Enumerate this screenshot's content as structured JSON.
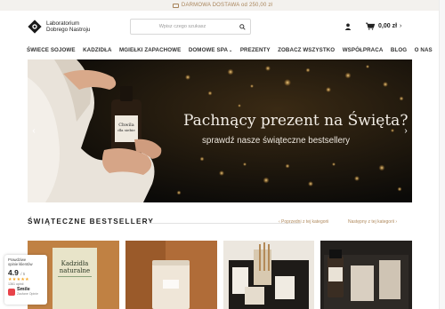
{
  "topbar": {
    "shipping_text": "DARMOWA DOSTAWA od 250,00 zł"
  },
  "header": {
    "logo_line1": "Laboratorium",
    "logo_line2": "Dobrego Nastroju",
    "search_placeholder": "Wpisz czego szukasz",
    "cart_total": "0,00 zł",
    "cart_caret": "›"
  },
  "nav": {
    "items": [
      {
        "label": "ŚWIECE SOJOWE"
      },
      {
        "label": "KADZIDŁA"
      },
      {
        "label": "MGIEŁKI ZAPACHOWE"
      },
      {
        "label": "DOMOWE SPA"
      },
      {
        "label": "PREZENTY"
      },
      {
        "label": "ZOBACZ WSZYSTKO"
      },
      {
        "label": "WSPÓŁPRACA"
      },
      {
        "label": "BLOG"
      },
      {
        "label": "O NAS"
      }
    ],
    "dropdown_caret": "⌄"
  },
  "banner": {
    "headline": "Pachnący prezent na Święta?",
    "subheadline": "sprawdź nasze świąteczne bestsellery",
    "bottle_label_line1": "Chwila",
    "bottle_label_line2": "dla siebie",
    "prev_arrow": "‹",
    "next_arrow": "›"
  },
  "section": {
    "title": "ŚWIĄTECZNE BESTSELLERY",
    "prev_link": "‹ Poprzedni z tej kategorii",
    "next_link": "Następny z tej kategorii ›"
  },
  "products": {
    "p1_label_line1": "Kadzidła",
    "p1_label_line2": "naturalne"
  },
  "review_widget": {
    "title_line1": "Prawdziwe",
    "title_line2": "opinie klientów",
    "rating": "4.9",
    "rating_of": "/ 5",
    "stars": "★★★★★",
    "count": "1361 opinii",
    "brand_name": "Smile",
    "brand_sub": "Zaufane Opinie"
  },
  "colors": {
    "accent": "#b08a5e",
    "topbar_bg": "#f3f1ee",
    "banner_bg": "#0e0d0b"
  },
  "icons": [
    "logo-icon",
    "search-icon",
    "user-icon",
    "cart-icon",
    "truck-icon",
    "chevron-left-icon",
    "chevron-right-icon",
    "star-icon"
  ]
}
